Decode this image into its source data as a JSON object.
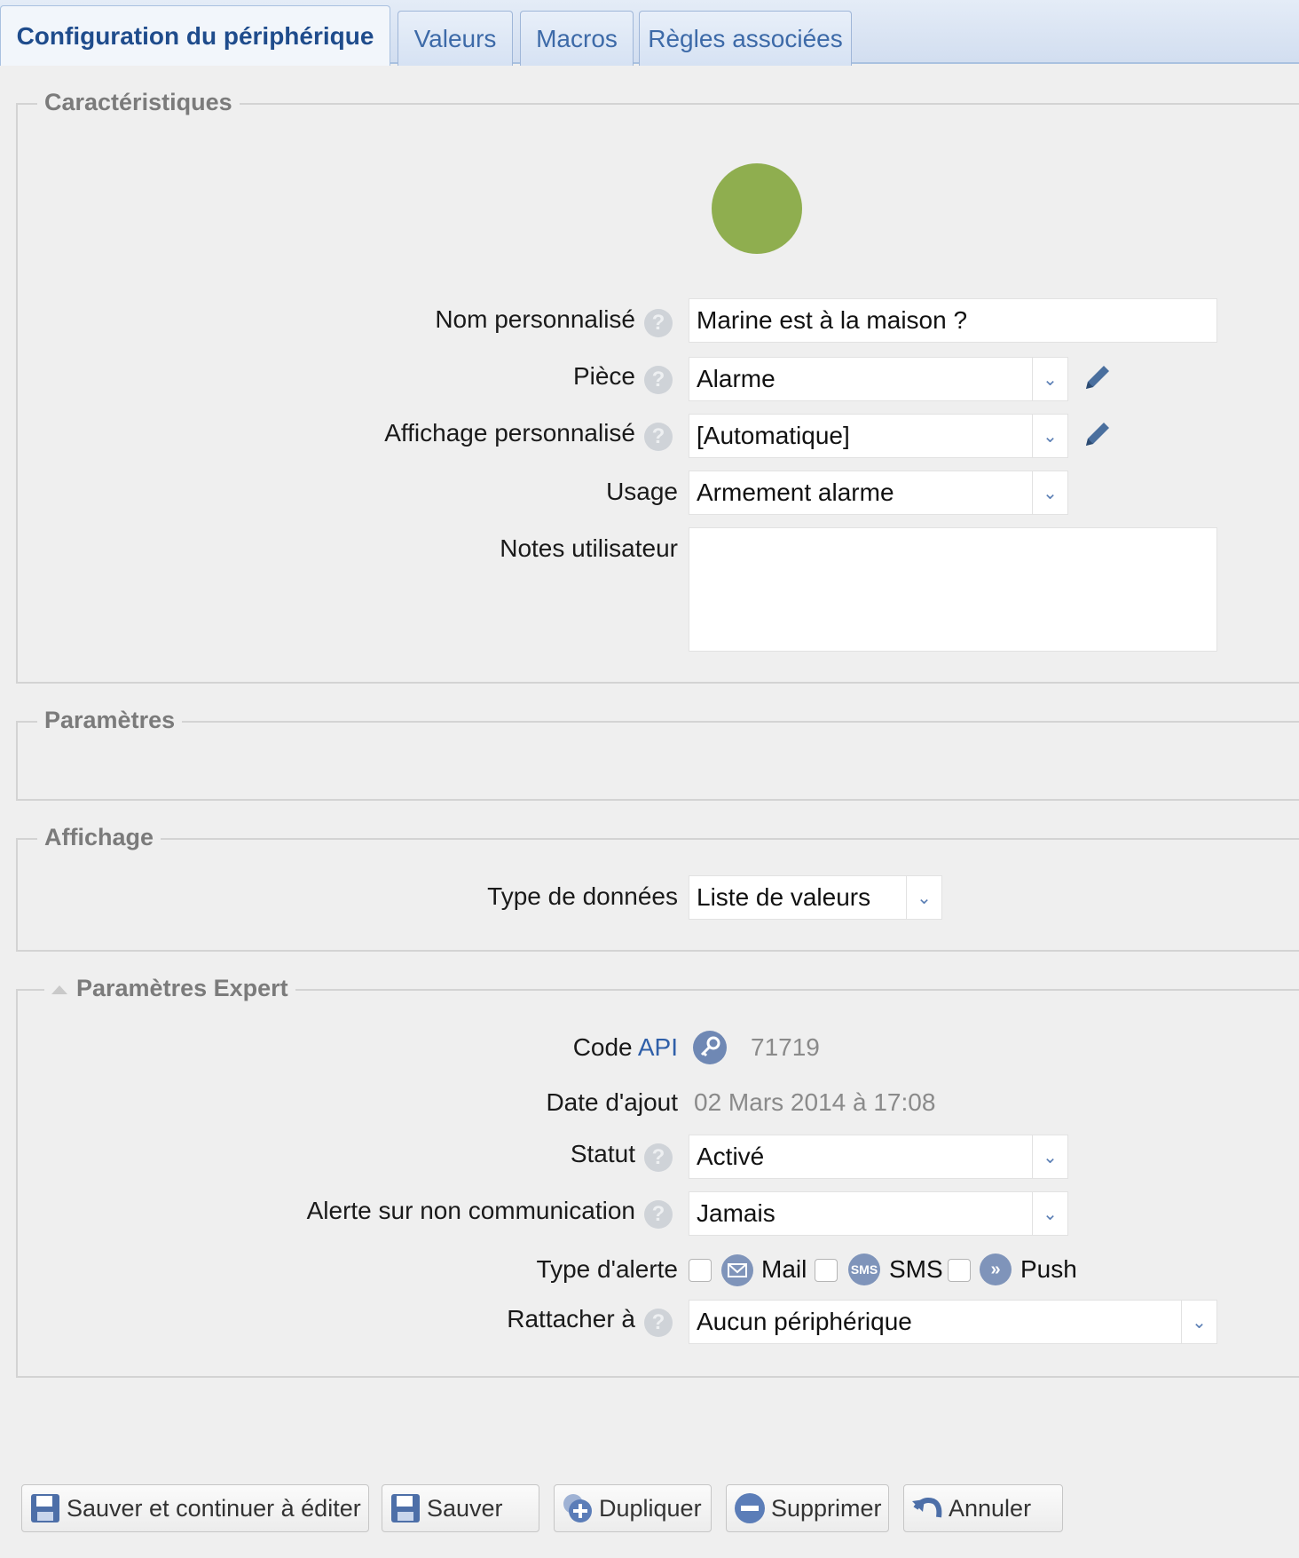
{
  "tabs": [
    "Configuration du périphérique",
    "Valeurs",
    "Macros",
    "Règles associées"
  ],
  "sections": {
    "caracteristiques": "Caractéristiques",
    "parametres": "Paramètres",
    "affichage": "Affichage",
    "expert": "Paramètres Expert"
  },
  "status_color": "#8fae4f",
  "fields": {
    "nom": {
      "label": "Nom personnalisé",
      "value": "Marine est à la maison ?"
    },
    "piece": {
      "label": "Pièce",
      "value": "Alarme"
    },
    "affichage": {
      "label": "Affichage personnalisé",
      "value": "[Automatique]"
    },
    "usage": {
      "label": "Usage",
      "value": "Armement alarme"
    },
    "notes": {
      "label": "Notes utilisateur",
      "value": ""
    },
    "type_donnees": {
      "label": "Type de données",
      "value": "Liste de valeurs"
    },
    "code_api": {
      "label_prefix": "Code",
      "label_api": "API",
      "value": "71719"
    },
    "date_ajout": {
      "label": "Date d'ajout",
      "value": "02 Mars 2014 à 17:08"
    },
    "statut": {
      "label": "Statut",
      "value": "Activé"
    },
    "alerte": {
      "label": "Alerte sur non communication",
      "value": "Jamais"
    },
    "type_alerte": {
      "label": "Type d'alerte",
      "options": [
        "Mail",
        "SMS",
        "Push"
      ],
      "sms_icon": "SMS"
    },
    "rattacher": {
      "label": "Rattacher à",
      "value": "Aucun périphérique"
    }
  },
  "help_glyph": "?",
  "buttons": {
    "save_continue": "Sauver et continuer à éditer",
    "save": "Sauver",
    "duplicate": "Dupliquer",
    "delete": "Supprimer",
    "cancel": "Annuler"
  }
}
